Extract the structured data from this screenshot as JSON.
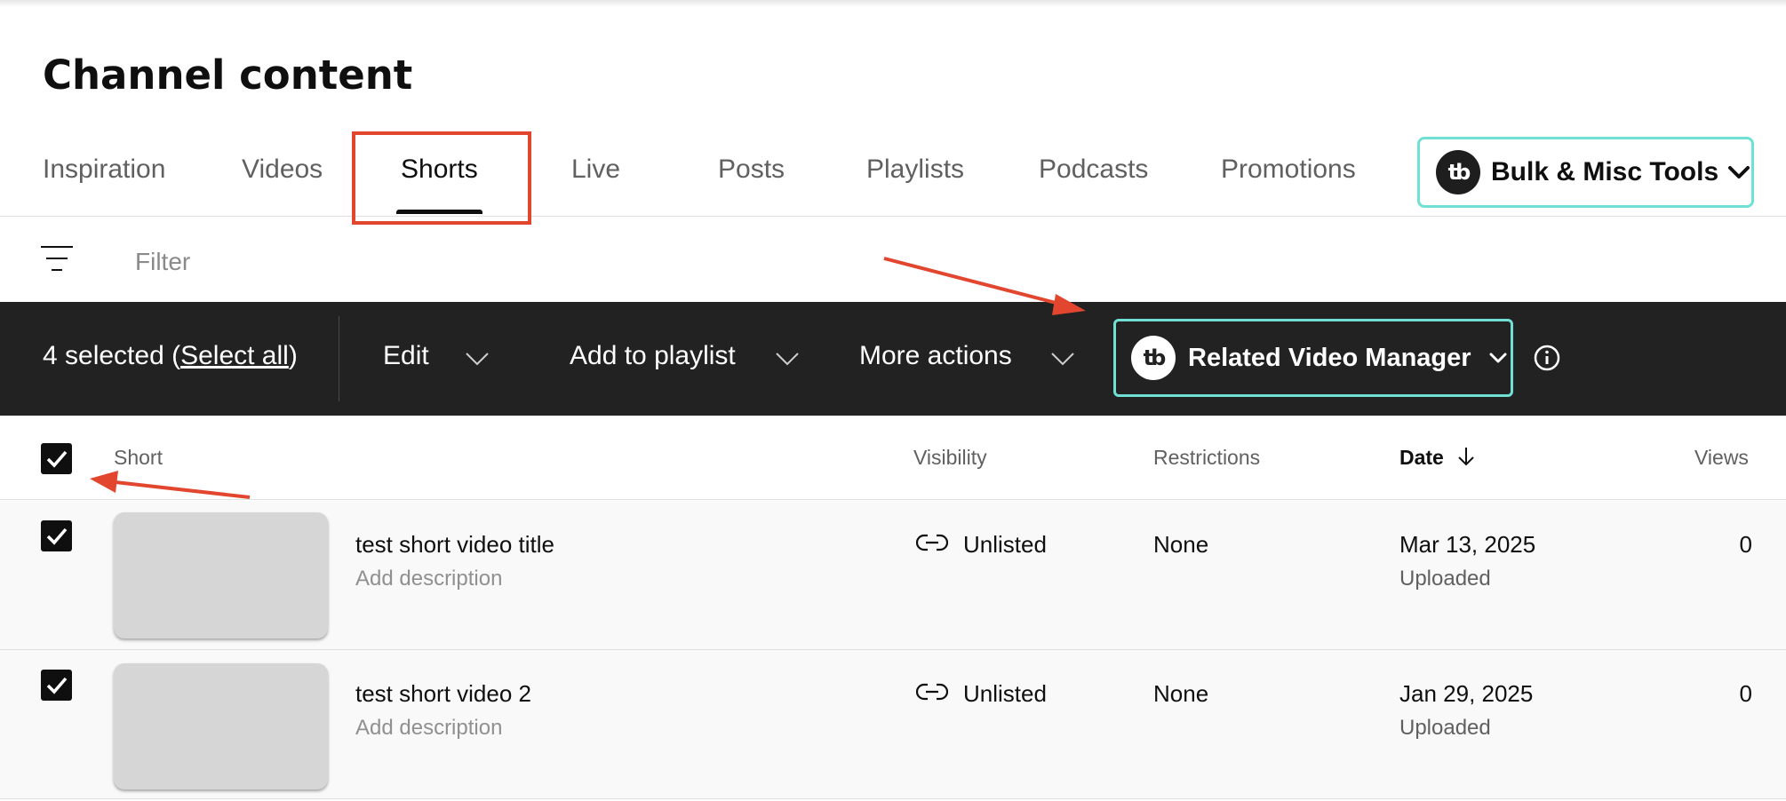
{
  "page": {
    "title": "Channel content"
  },
  "tabs": [
    {
      "label": "Inspiration",
      "active": false
    },
    {
      "label": "Videos",
      "active": false
    },
    {
      "label": "Shorts",
      "active": true
    },
    {
      "label": "Live",
      "active": false
    },
    {
      "label": "Posts",
      "active": false
    },
    {
      "label": "Playlists",
      "active": false
    },
    {
      "label": "Podcasts",
      "active": false
    },
    {
      "label": "Promotions",
      "active": false
    }
  ],
  "bulk_tools": {
    "logo": "tb",
    "label": "Bulk & Misc Tools",
    "icon": "chevron-down-icon"
  },
  "filter": {
    "placeholder": "Filter",
    "icon": "filter-icon"
  },
  "action_bar": {
    "selected_prefix": "4 selected (",
    "select_all": "Select all",
    "selected_suffix": ")",
    "edit": "Edit",
    "add_to_playlist": "Add to playlist",
    "more_actions": "More actions",
    "related_video_manager": {
      "logo": "tb",
      "label": "Related Video Manager"
    },
    "info_icon": "info-icon"
  },
  "columns": {
    "short": "Short",
    "visibility": "Visibility",
    "restrictions": "Restrictions",
    "date": "Date",
    "views": "Views"
  },
  "rows": [
    {
      "checked": true,
      "title": "test short video title",
      "description": "Add description",
      "visibility": "Unlisted",
      "restrictions": "None",
      "date": "Mar 13, 2025",
      "date_status": "Uploaded",
      "views": "0"
    },
    {
      "checked": true,
      "title": "test short video 2",
      "description": "Add description",
      "visibility": "Unlisted",
      "restrictions": "None",
      "date": "Jan 29, 2025",
      "date_status": "Uploaded",
      "views": "0"
    }
  ],
  "colors": {
    "accent_teal": "#6fe0d3",
    "annotation_red": "#e2462f",
    "action_bar_bg": "#222222"
  }
}
